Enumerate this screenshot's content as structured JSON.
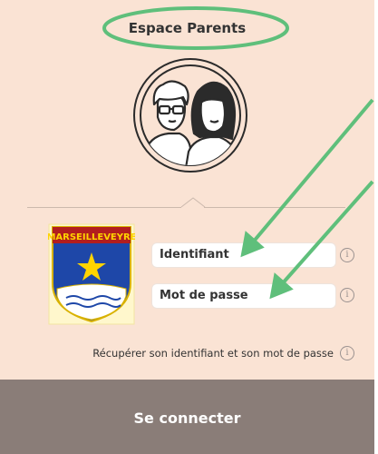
{
  "header": {
    "title": "Espace Parents"
  },
  "crest": {
    "label": "MARSEILLEVEYRE",
    "icon": "school-crest-icon"
  },
  "login": {
    "identifier_placeholder": "Identifiant",
    "password_placeholder": "Mot de passe",
    "recover_link": "Récupérer son identifiant et son mot de passe",
    "submit_label": "Se connecter",
    "info_glyph": "i"
  },
  "colors": {
    "panel_bg": "#fae3d4",
    "button_bg": "#8a7d78",
    "annotation_green": "#5fbf7b"
  }
}
